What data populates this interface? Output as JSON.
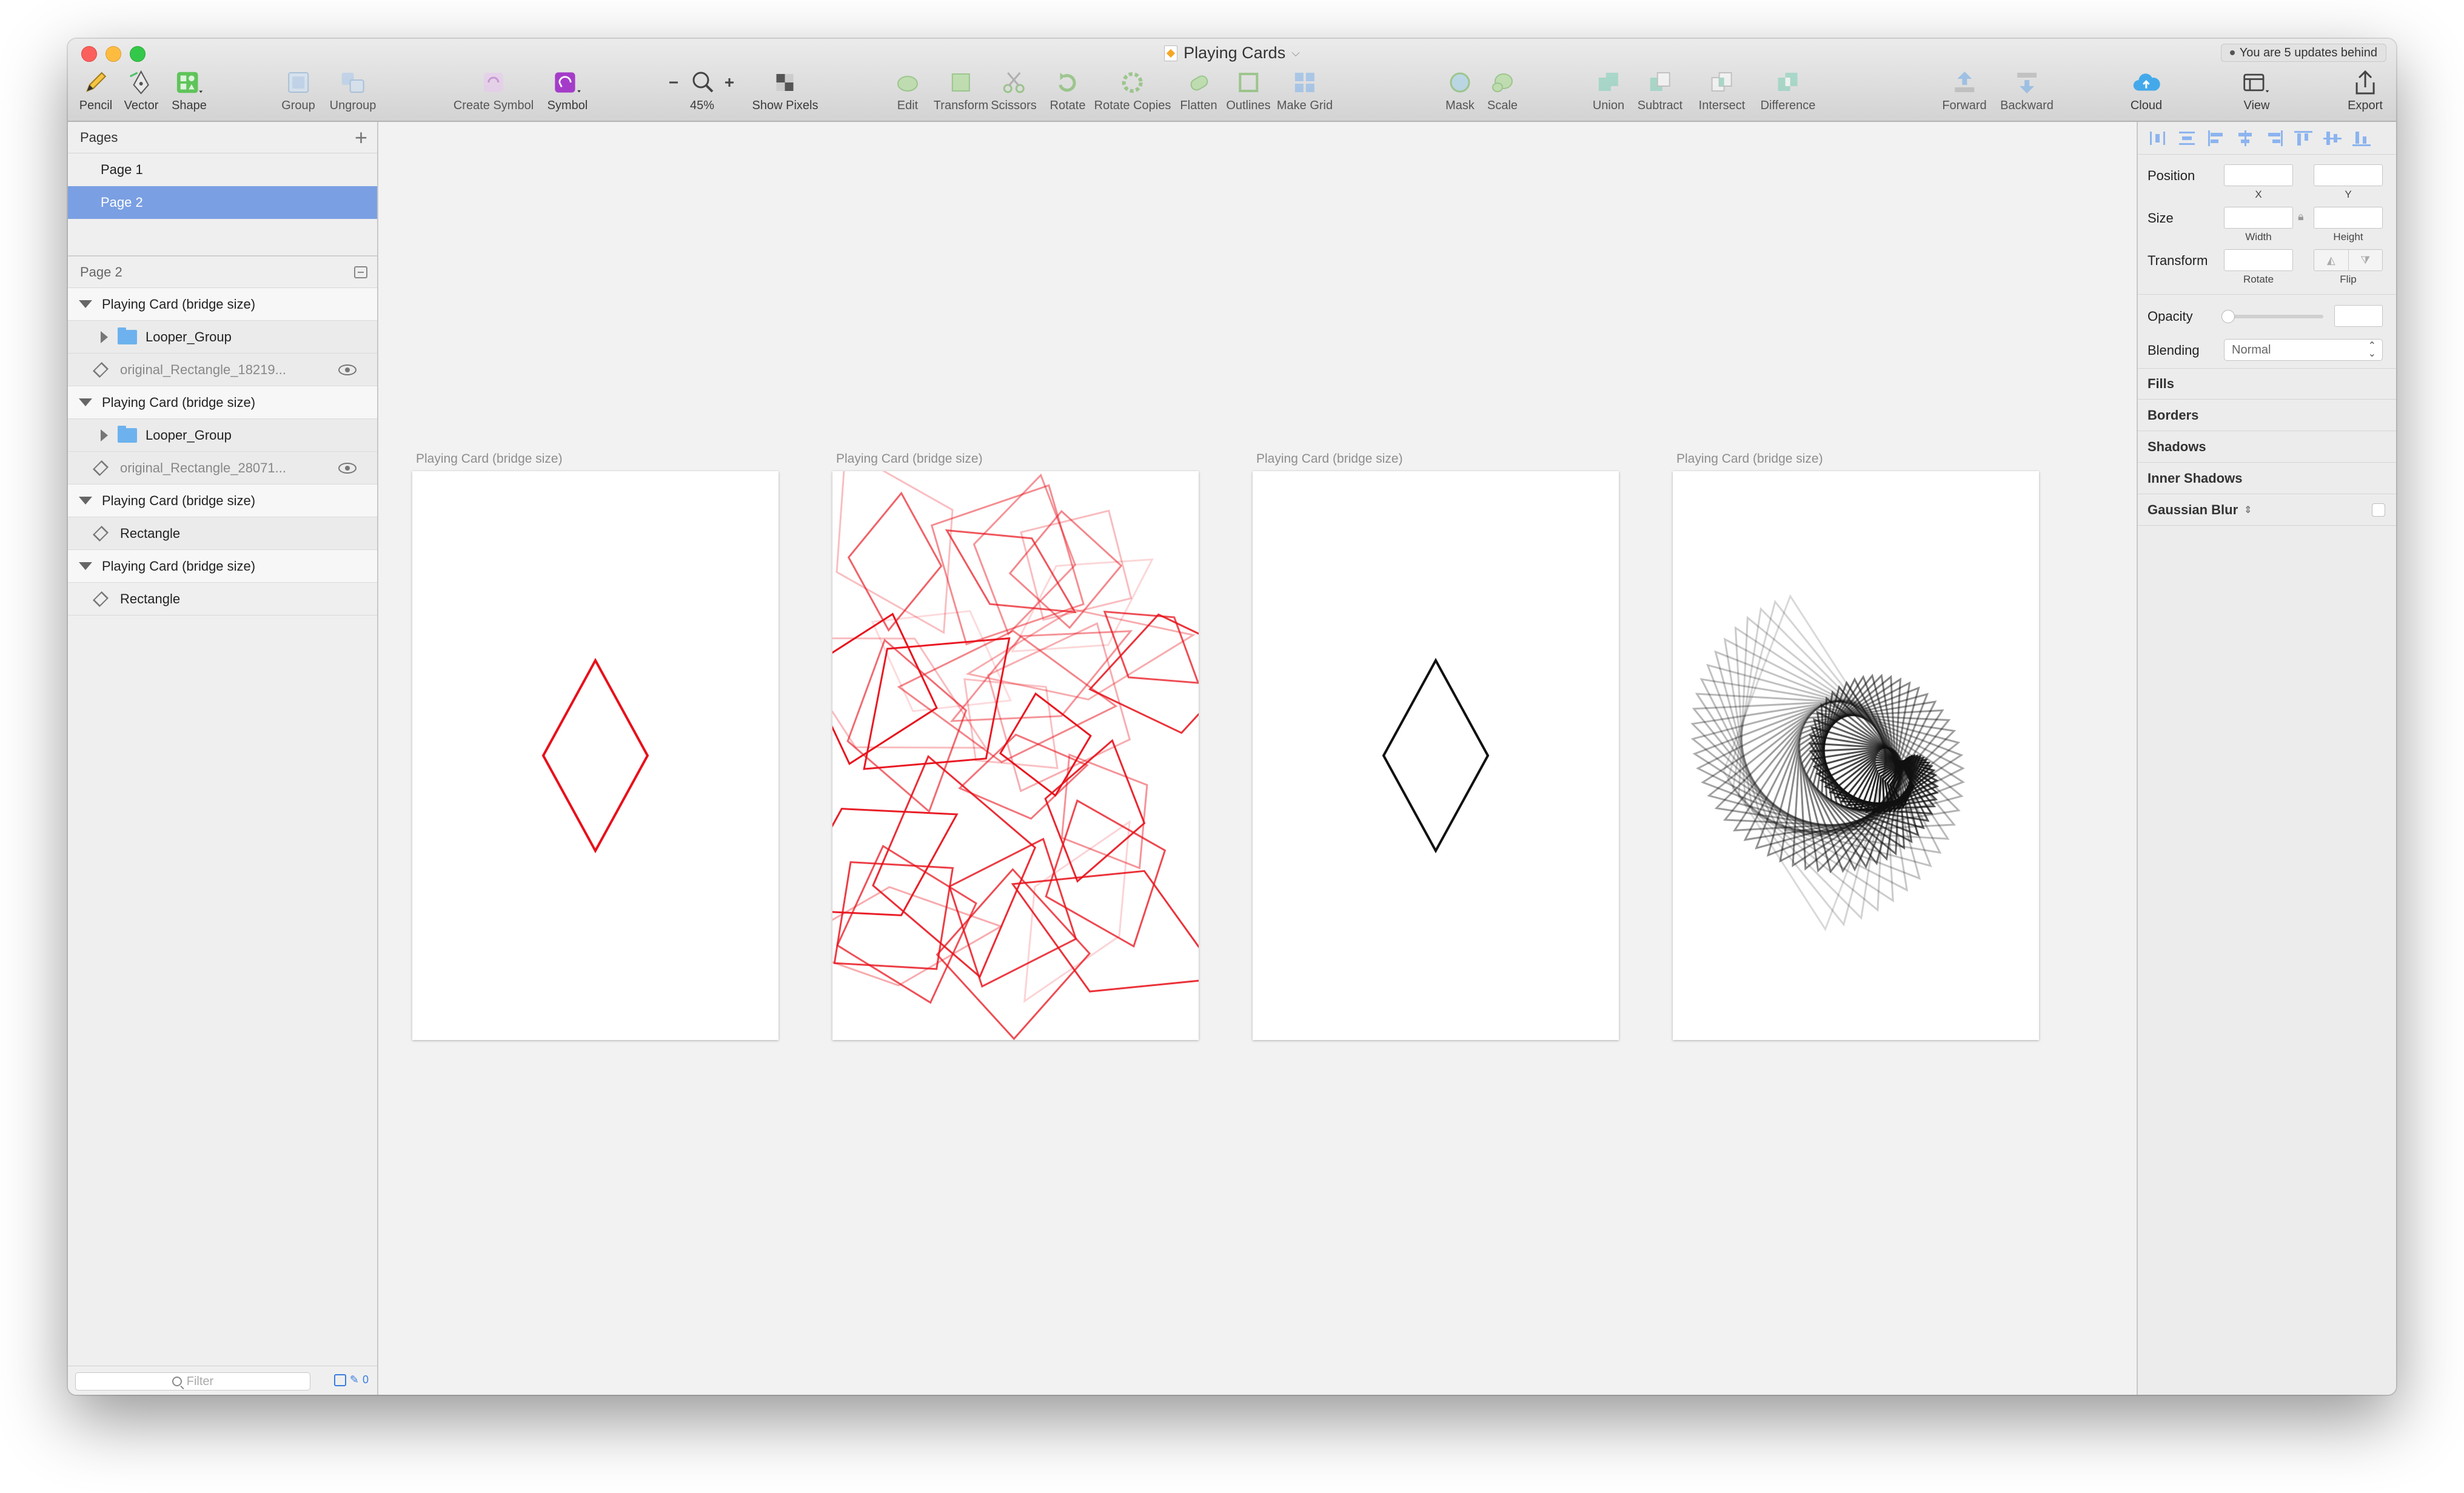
{
  "window": {
    "title": "Playing Cards",
    "update_notice": "You are 5 updates behind"
  },
  "toolbar": {
    "pencil": "Pencil",
    "vector": "Vector",
    "shape": "Shape",
    "group": "Group",
    "ungroup": "Ungroup",
    "create_symbol": "Create Symbol",
    "symbol": "Symbol",
    "zoom_level": "45%",
    "show_pixels": "Show Pixels",
    "edit": "Edit",
    "transform": "Transform",
    "scissors": "Scissors",
    "rotate": "Rotate",
    "rotate_copies": "Rotate Copies",
    "flatten": "Flatten",
    "outlines": "Outlines",
    "make_grid": "Make Grid",
    "mask": "Mask",
    "scale": "Scale",
    "union": "Union",
    "subtract": "Subtract",
    "intersect": "Intersect",
    "difference": "Difference",
    "forward": "Forward",
    "backward": "Backward",
    "cloud": "Cloud",
    "view": "View",
    "export": "Export"
  },
  "pages": {
    "header": "Pages",
    "items": [
      {
        "label": "Page 1",
        "selected": false
      },
      {
        "label": "Page 2",
        "selected": true
      }
    ]
  },
  "layers": {
    "header": "Page 2",
    "items": [
      {
        "label": "Playing Card (bridge size)"
      },
      {
        "label": "Looper_Group"
      },
      {
        "label": "original_Rectangle_18219..."
      },
      {
        "label": "Playing Card (bridge size)"
      },
      {
        "label": "Looper_Group"
      },
      {
        "label": "original_Rectangle_28071..."
      },
      {
        "label": "Playing Card (bridge size)"
      },
      {
        "label": "Rectangle"
      },
      {
        "label": "Playing Card (bridge size)"
      },
      {
        "label": "Rectangle"
      }
    ],
    "filter_placeholder": "Filter",
    "filter_count": "0"
  },
  "canvas": {
    "artboards": [
      {
        "label": "Playing Card (bridge size)",
        "style": "red-diamond"
      },
      {
        "label": "Playing Card (bridge size)",
        "style": "red-scatter"
      },
      {
        "label": "Playing Card (bridge size)",
        "style": "black-diamond"
      },
      {
        "label": "Playing Card (bridge size)",
        "style": "black-spiral"
      }
    ],
    "colors": {
      "red": "#e8101a",
      "black": "#111111"
    }
  },
  "inspector": {
    "position": "Position",
    "x": "X",
    "y": "Y",
    "size": "Size",
    "width": "Width",
    "height": "Height",
    "transform": "Transform",
    "rotate": "Rotate",
    "flip": "Flip",
    "opacity": "Opacity",
    "blending": "Blending",
    "blending_value": "Normal",
    "fills": "Fills",
    "borders": "Borders",
    "shadows": "Shadows",
    "inner_shadows": "Inner Shadows",
    "gaussian_blur": "Gaussian Blur"
  }
}
